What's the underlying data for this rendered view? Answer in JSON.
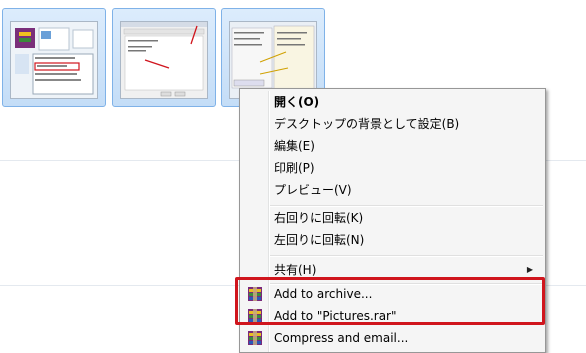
{
  "thumbnails": [
    {
      "name": "winrar-context-menu-screenshot"
    },
    {
      "name": "archive-options-dialog-screenshot"
    },
    {
      "name": "settings-dialog-screenshot"
    }
  ],
  "context_menu": {
    "items": [
      {
        "label": "開く(O)",
        "bold": true
      },
      {
        "label": "デスクトップの背景として設定(B)"
      },
      {
        "label": "編集(E)"
      },
      {
        "label": "印刷(P)"
      },
      {
        "label": "プレビュー(V)"
      },
      {
        "label": "右回りに回転(K)"
      },
      {
        "label": "左回りに回転(N)"
      },
      {
        "label": "共有(H)",
        "submenu": true
      },
      {
        "label": "Add to archive...",
        "icon": "winrar-icon"
      },
      {
        "label": "Add to \"Pictures.rar\"",
        "icon": "winrar-icon"
      },
      {
        "label": "Compress and email...",
        "icon": "winrar-icon"
      }
    ]
  },
  "colors": {
    "highlight_border": "#d0151d",
    "thumbnail_selected": "#cce4fb",
    "menu_background": "#f5f5f5"
  }
}
